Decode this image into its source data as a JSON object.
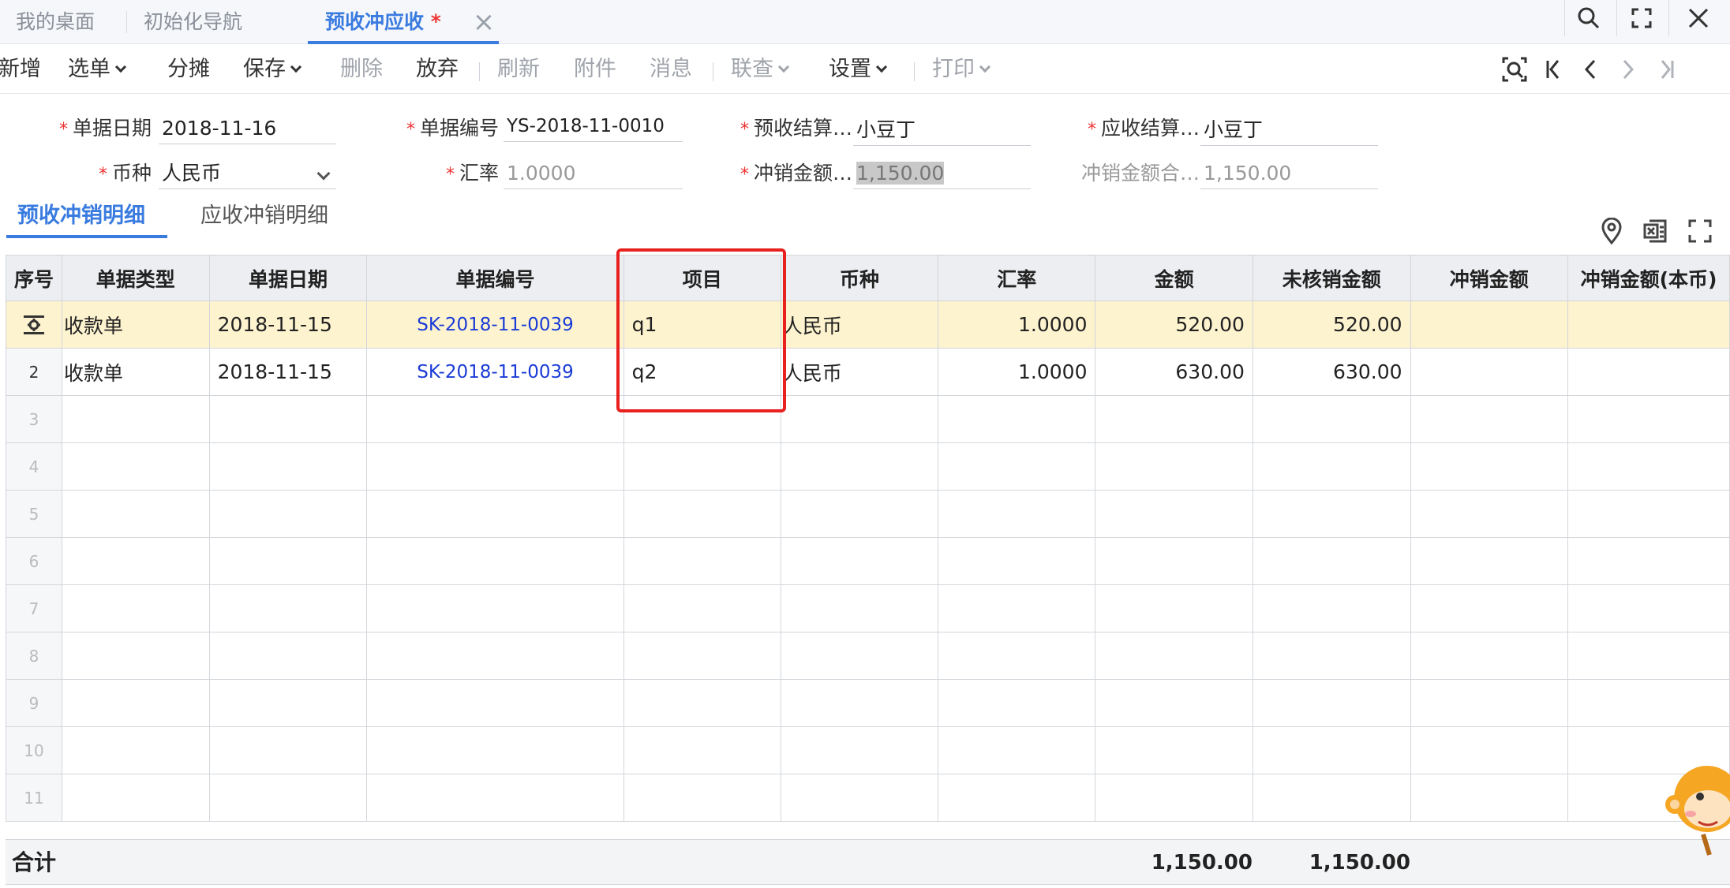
{
  "tabs": [
    {
      "label": "我的桌面"
    },
    {
      "label": "初始化导航"
    },
    {
      "label": "预收冲应收",
      "modified": "*"
    }
  ],
  "toolbar": {
    "new": "新增",
    "select": "选单",
    "allocate": "分摊",
    "save": "保存",
    "delete": "删除",
    "abandon": "放弃",
    "refresh": "刷新",
    "attach": "附件",
    "message": "消息",
    "linked": "联查",
    "settings": "设置",
    "print": "打印"
  },
  "form": {
    "doc_date": {
      "label": "单据日期",
      "value": "2018-11-16"
    },
    "doc_no": {
      "label": "单据编号",
      "value": "YS-2018-11-0010"
    },
    "prepay_party": {
      "label": "预收结算…",
      "value": "小豆丁"
    },
    "receivable_party": {
      "label": "应收结算…",
      "value": "小豆丁"
    },
    "currency": {
      "label": "币种",
      "value": "人民币"
    },
    "rate": {
      "label": "汇率",
      "value": "1.0000"
    },
    "writeoff_amount": {
      "label": "冲销金额…",
      "value": "1,150.00"
    },
    "writeoff_total": {
      "label": "冲销金额合…",
      "value": "1,150.00"
    }
  },
  "subtabs": {
    "prepay_detail": "预收冲销明细",
    "receivable_detail": "应收冲销明细"
  },
  "grid": {
    "columns": [
      "序号",
      "单据类型",
      "单据日期",
      "单据编号",
      "项目",
      "币种",
      "汇率",
      "金额",
      "未核销金额",
      "冲销金额",
      "冲销金额(本币)"
    ],
    "rows": [
      {
        "idx": "",
        "type": "收款单",
        "date": "2018-11-15",
        "no": "SK-2018-11-0039",
        "item": "q1",
        "currency": "人民币",
        "rate": "1.0000",
        "amount": "520.00",
        "unsettled": "520.00",
        "writeoff": "",
        "writeoff_local": ""
      },
      {
        "idx": "2",
        "type": "收款单",
        "date": "2018-11-15",
        "no": "SK-2018-11-0039",
        "item": "q2",
        "currency": "人民币",
        "rate": "1.0000",
        "amount": "630.00",
        "unsettled": "630.00",
        "writeoff": "",
        "writeoff_local": ""
      }
    ],
    "empty_rows": [
      "3",
      "4",
      "5",
      "6",
      "7",
      "8",
      "9",
      "10",
      "11"
    ]
  },
  "footer": {
    "label": "合计",
    "amount_total": "1,150.00",
    "unsettled_total": "1,150.00"
  },
  "colors": {
    "accent": "#3a7be0",
    "link": "#1a3bd6",
    "highlight": "#e8201e",
    "current_row": "#fdf3cf"
  }
}
